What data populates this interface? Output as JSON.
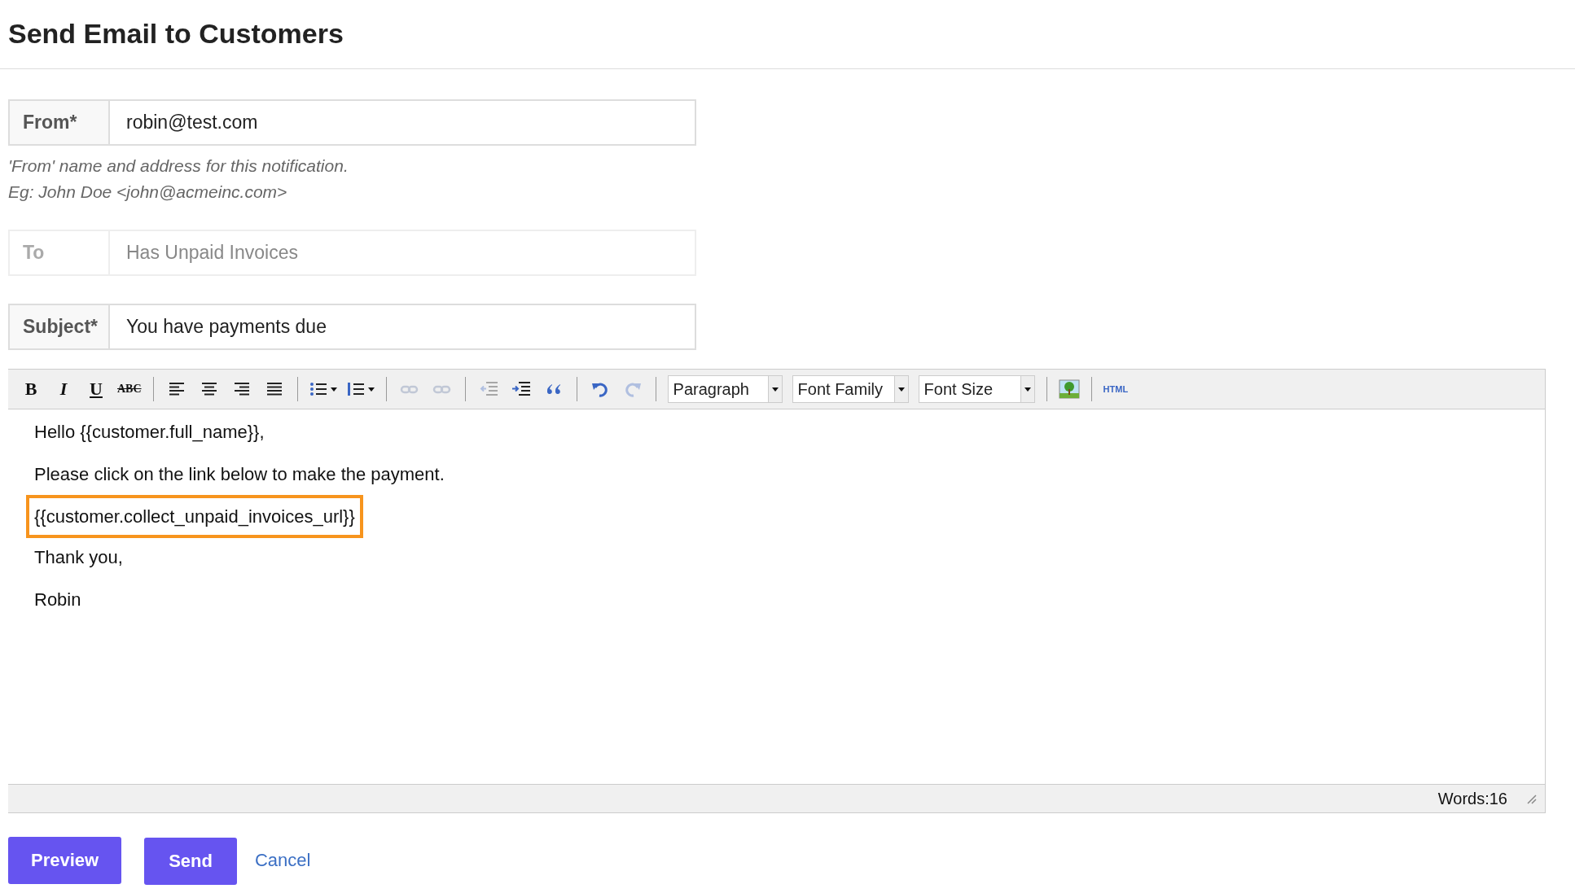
{
  "title": "Send Email to Customers",
  "fields": [
    {
      "label": "From*",
      "value": "robin@test.com",
      "disabled": false,
      "hint": [
        "'From' name and address for this notification.",
        "Eg: John Doe <john@acmeinc.com>"
      ]
    },
    {
      "label": "To",
      "value": "Has Unpaid Invoices",
      "disabled": true
    },
    {
      "label": "Subject*",
      "value": "You have payments due",
      "disabled": false
    }
  ],
  "toolbar": {
    "buttons": [
      {
        "label": "B",
        "disabled": false
      },
      {
        "label": "I",
        "disabled": false
      },
      {
        "label": "U",
        "disabled": false
      },
      {
        "label": "ABC",
        "disabled": false
      },
      {
        "disabled": false
      },
      {
        "disabled": false
      },
      {
        "disabled": false
      },
      {
        "disabled": false
      },
      {
        "disabled": false
      },
      {
        "disabled": false
      },
      {
        "disabled": true
      },
      {
        "disabled": true
      },
      {
        "disabled": true
      },
      {
        "disabled": false
      },
      {
        "disabled": false
      },
      {
        "disabled": false
      },
      {
        "disabled": true
      }
    ],
    "selects": [
      "Paragraph",
      "Font Family",
      "Font Size"
    ],
    "html_button": "HTML"
  },
  "editor": {
    "paragraphs": [
      {
        "text": "Hello {{customer.full_name}},",
        "highlighted": false
      },
      {
        "text": "Please click on the link below to make the payment.",
        "highlighted": false
      },
      {
        "text": "{{customer.collect_unpaid_invoices_url}}",
        "highlighted": true
      },
      {
        "text": "Thank you,",
        "highlighted": false
      },
      {
        "text": "Robin",
        "highlighted": false
      }
    ],
    "word_count": "Words:16"
  },
  "actions": {
    "preview": "Preview",
    "send": "Send",
    "cancel": "Cancel"
  }
}
